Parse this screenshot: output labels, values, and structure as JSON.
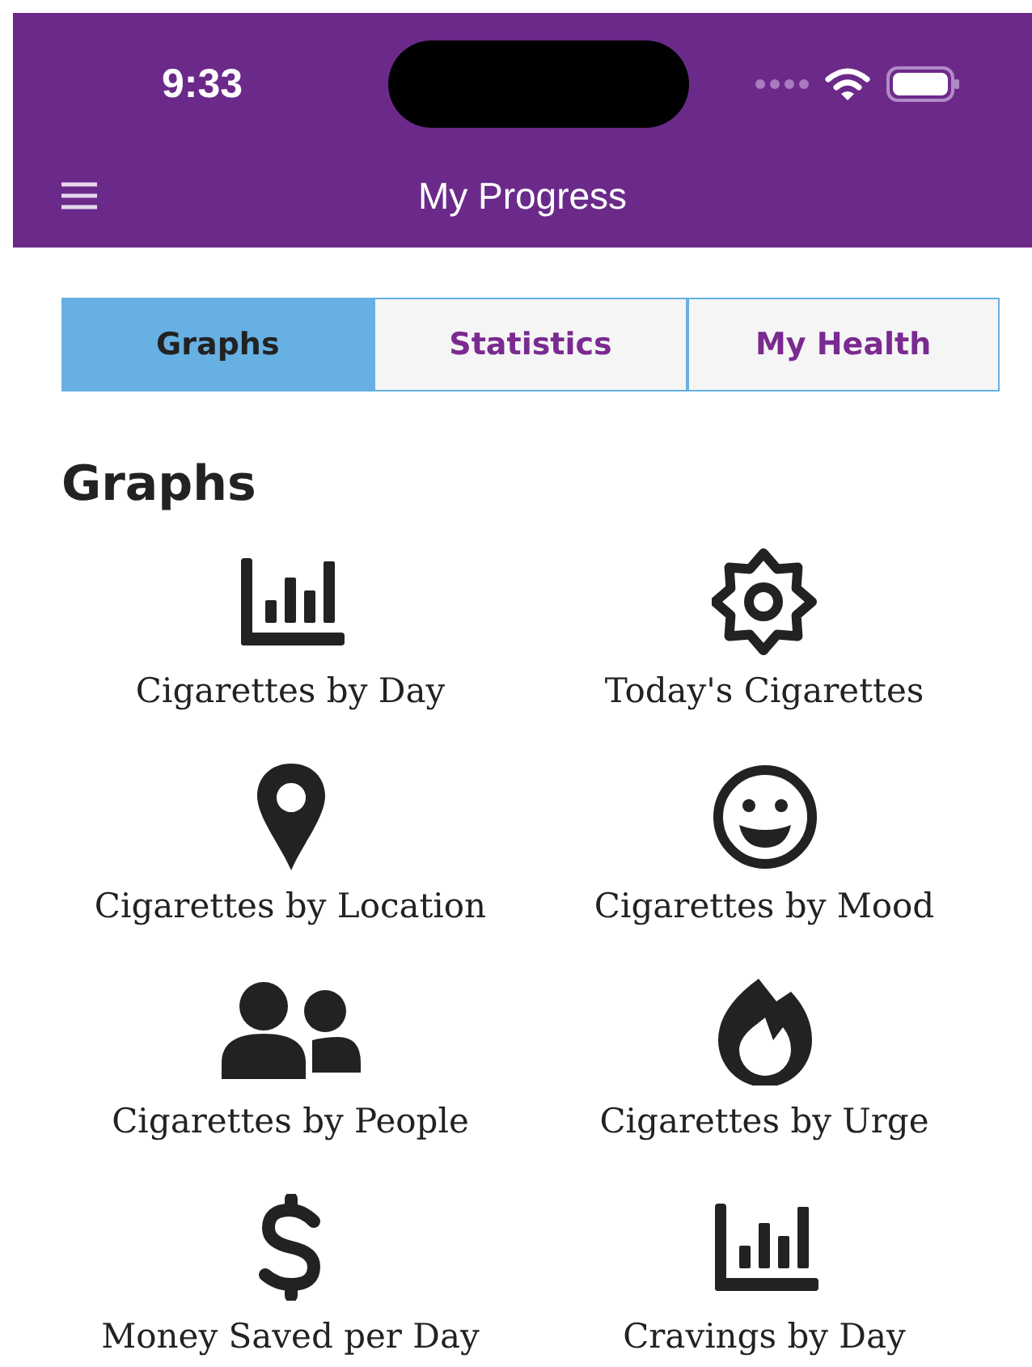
{
  "status_bar": {
    "time": "9:33"
  },
  "nav_bar": {
    "title": "My Progress"
  },
  "tabs": [
    {
      "label": "Graphs",
      "selected": true
    },
    {
      "label": "Statistics",
      "selected": false
    },
    {
      "label": "My Health",
      "selected": false
    }
  ],
  "heading": "Graphs",
  "items": [
    {
      "label": "Cigarettes by Day",
      "kind": "bars"
    },
    {
      "label": "Today's Cigarettes",
      "kind": "gear"
    },
    {
      "label": "Cigarettes by Location",
      "kind": "pin"
    },
    {
      "label": "Cigarettes by Mood",
      "kind": "smile"
    },
    {
      "label": "Cigarettes by People",
      "kind": "people"
    },
    {
      "label": "Cigarettes by Urge",
      "kind": "flame"
    },
    {
      "label": "Money Saved per Day",
      "kind": "dollar"
    },
    {
      "label": "Cravings by Day",
      "kind": "bars"
    }
  ]
}
